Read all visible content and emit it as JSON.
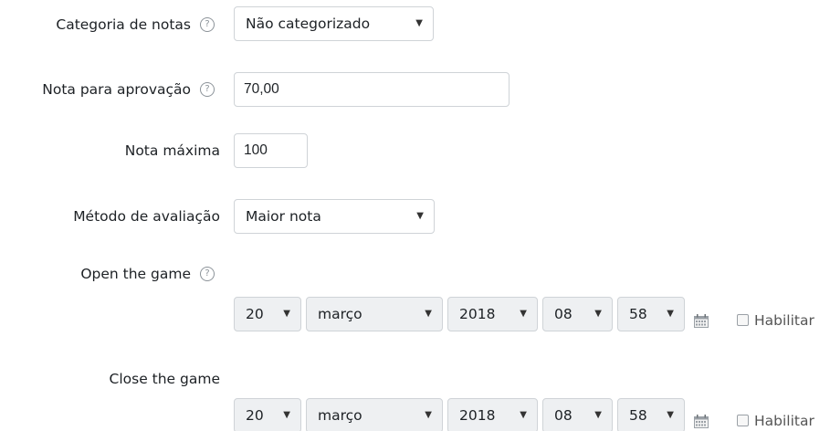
{
  "grade_category": {
    "label": "Categoria de notas",
    "value": "Não categorizado"
  },
  "grade_pass": {
    "label": "Nota para aprovação",
    "value": "70,00"
  },
  "max_grade": {
    "label": "Nota máxima",
    "value": "100"
  },
  "grade_method": {
    "label": "Método de avaliação",
    "value": "Maior nota"
  },
  "open_game": {
    "label": "Open the game",
    "day": "20",
    "month": "março",
    "year": "2018",
    "hour": "08",
    "minute": "58",
    "enable_label": "Habilitar"
  },
  "close_game": {
    "label": "Close the game",
    "day": "20",
    "month": "março",
    "year": "2018",
    "hour": "08",
    "minute": "58",
    "enable_label": "Habilitar"
  },
  "icons": {
    "help": "question-circle-icon",
    "calendar": "calendar-icon"
  },
  "colors": {
    "disabled_field_bg": "#eef0f2",
    "border": "#cfd3d7",
    "text": "#1d2125",
    "icon": "#8c9399"
  }
}
